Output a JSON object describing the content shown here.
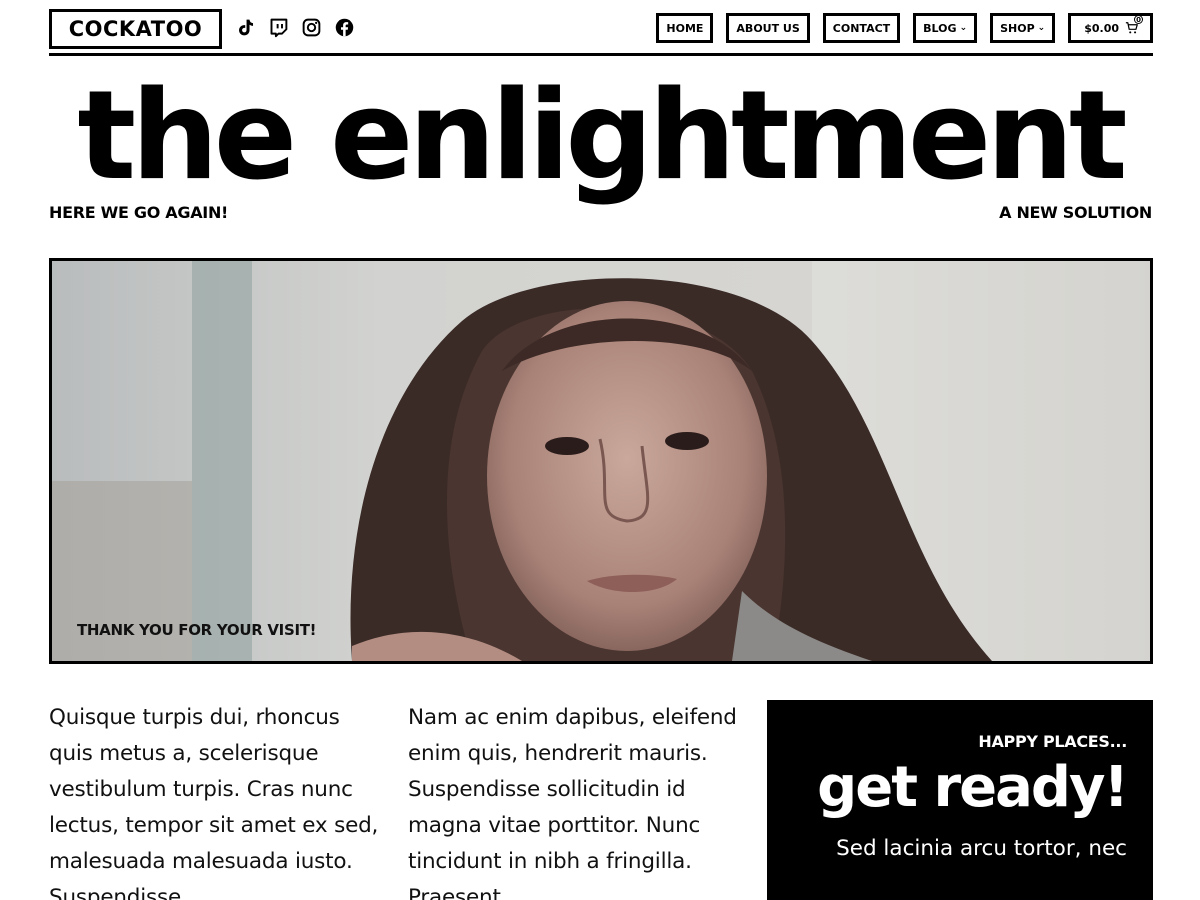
{
  "header": {
    "logo": "COCKATOO",
    "socials": [
      {
        "icon": "tiktok-icon"
      },
      {
        "icon": "twitch-icon"
      },
      {
        "icon": "instagram-icon"
      },
      {
        "icon": "facebook-icon"
      }
    ],
    "nav": [
      {
        "label": "HOME",
        "has_dropdown": false
      },
      {
        "label": "ABOUT US",
        "has_dropdown": false
      },
      {
        "label": "CONTACT",
        "has_dropdown": false
      },
      {
        "label": "BLOG",
        "has_dropdown": true
      },
      {
        "label": "SHOP",
        "has_dropdown": true
      }
    ],
    "cart": {
      "total": "$0.00",
      "count": "0",
      "icon": "cart-icon"
    }
  },
  "hero": {
    "title": "the enlightment",
    "tag_left": "HERE WE GO AGAIN!",
    "tag_right": "A NEW SOLUTION",
    "caption": "THANK YOU FOR YOUR VISIT!"
  },
  "columns": [
    {
      "text": "Quisque turpis dui, rhoncus quis metus a, scelerisque vestibulum turpis. Cras nunc lectus, tempor sit amet ex sed, malesuada malesuada iusto. Suspendisse"
    },
    {
      "text": "Nam ac enim dapibus, eleifend enim quis, hendrerit mauris. Suspendisse sollicitudin id magna vitae porttitor. Nunc tincidunt in nibh a fringilla. Praesent"
    }
  ],
  "promo": {
    "kicker": "HAPPY PLACES...",
    "title": "get ready!",
    "body": "Sed lacinia arcu tortor, nec"
  },
  "colors": {
    "text": "#000000",
    "background": "#ffffff",
    "promo_background": "#000000",
    "promo_text": "#ffffff"
  }
}
